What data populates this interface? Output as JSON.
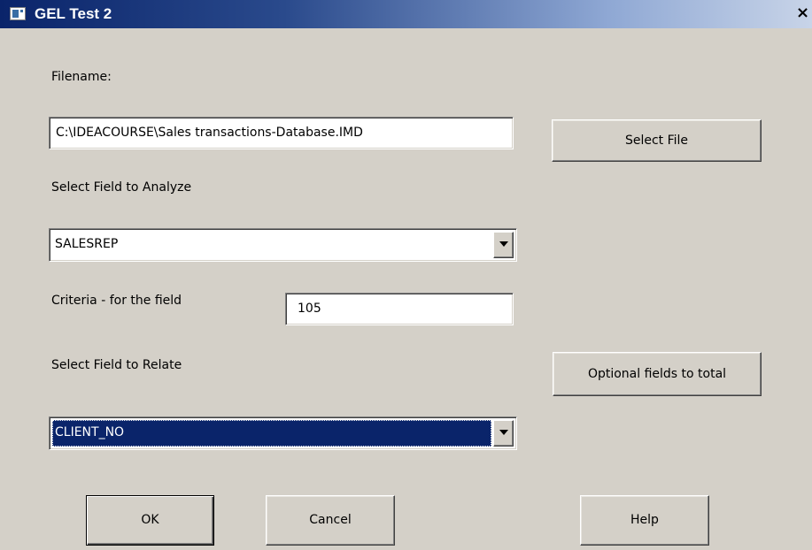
{
  "window": {
    "title": "GEL Test 2",
    "close_glyph": "×",
    "icon": "app-window-icon"
  },
  "form": {
    "filename_label": "Filename:",
    "filename_value": "C:\\IDEACOURSE\\Sales transactions-Database.IMD",
    "select_file_button": "Select File",
    "analyze_field_label": "Select Field to Analyze",
    "analyze_field_value": "SALESREP",
    "criteria_label": "Criteria - for the field",
    "criteria_value": "105",
    "relate_field_label": "Select Field to Relate",
    "optional_fields_button": "Optional fields to total",
    "relate_field_value": "CLIENT_NO"
  },
  "buttons": {
    "ok": "OK",
    "cancel": "Cancel",
    "help": "Help"
  },
  "colors": {
    "dialog_background": "#d4d0c8",
    "titlebar_start": "#0a246a",
    "selection_highlight": "#0a246a"
  }
}
